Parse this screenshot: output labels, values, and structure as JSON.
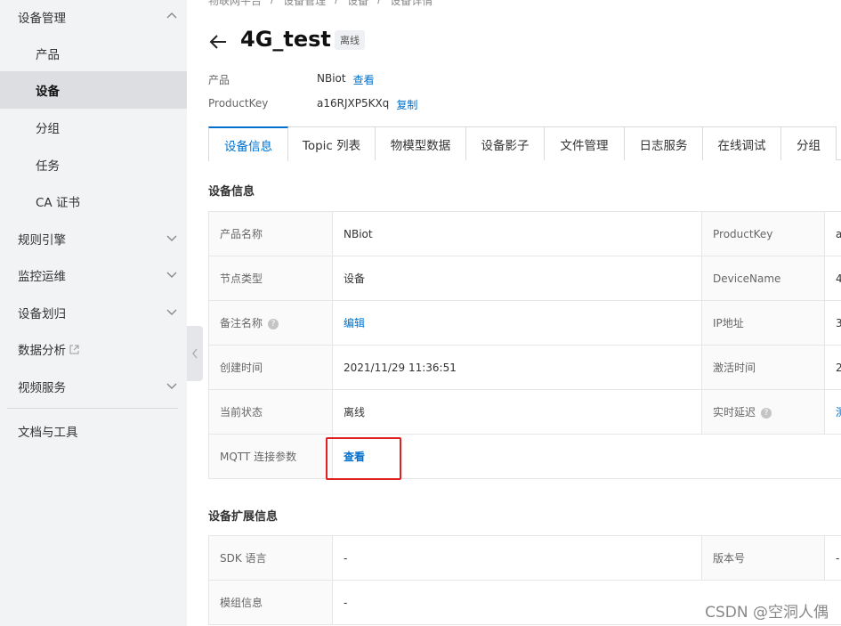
{
  "sidebar": {
    "groups": {
      "device_mgmt": "设备管理",
      "rules": "规则引擎",
      "monitoring": "监控运维",
      "device_assign": "设备划归",
      "data_analysis": "数据分析",
      "video": "视频服务",
      "docs": "文档与工具"
    },
    "sub_items": [
      "产品",
      "设备",
      "分组",
      "任务",
      "CA 证书"
    ],
    "active_sub": "设备"
  },
  "breadcrumb": [
    "物联网平台",
    "/",
    "设备管理",
    "/",
    "设备",
    "/",
    "设备详情"
  ],
  "header": {
    "title": "4G_test",
    "status": "离线"
  },
  "meta": {
    "product_label": "产品",
    "product_value": "NBiot",
    "product_link": "查看",
    "key_label": "ProductKey",
    "key_value": "a16RJXP5KXq",
    "key_link": "复制"
  },
  "tabs": [
    "设备信息",
    "Topic 列表",
    "物模型数据",
    "设备影子",
    "文件管理",
    "日志服务",
    "在线调试",
    "分组"
  ],
  "active_tab": "设备信息",
  "device_info": {
    "title": "设备信息",
    "rows": [
      {
        "k1": "产品名称",
        "v1": "NBiot",
        "k2": "ProductKey",
        "v2": "a"
      },
      {
        "k1": "节点类型",
        "v1": "设备",
        "k2": "DeviceName",
        "v2": "4"
      },
      {
        "k1": "备注名称",
        "v1": "编辑",
        "k2": "IP地址",
        "v2": "3"
      },
      {
        "k1": "创建时间",
        "v1": "2021/11/29 11:36:51",
        "k2": "激活时间",
        "v2": "2"
      },
      {
        "k1": "当前状态",
        "v1": "离线",
        "k2": "实时延迟",
        "v2": "测"
      },
      {
        "k1": "MQTT 连接参数",
        "v1": "查看"
      }
    ]
  },
  "ext_info": {
    "title": "设备扩展信息",
    "rows": [
      {
        "k1": "SDK 语言",
        "v1": "-",
        "k2": "版本号",
        "v2": "-"
      },
      {
        "k1": "模组信息",
        "v1": "-"
      }
    ]
  },
  "watermark": "CSDN @空洞人偶",
  "colors": {
    "accent": "#0070cc",
    "highlight": "#e02020",
    "sidebar_bg": "#f2f3f5"
  }
}
